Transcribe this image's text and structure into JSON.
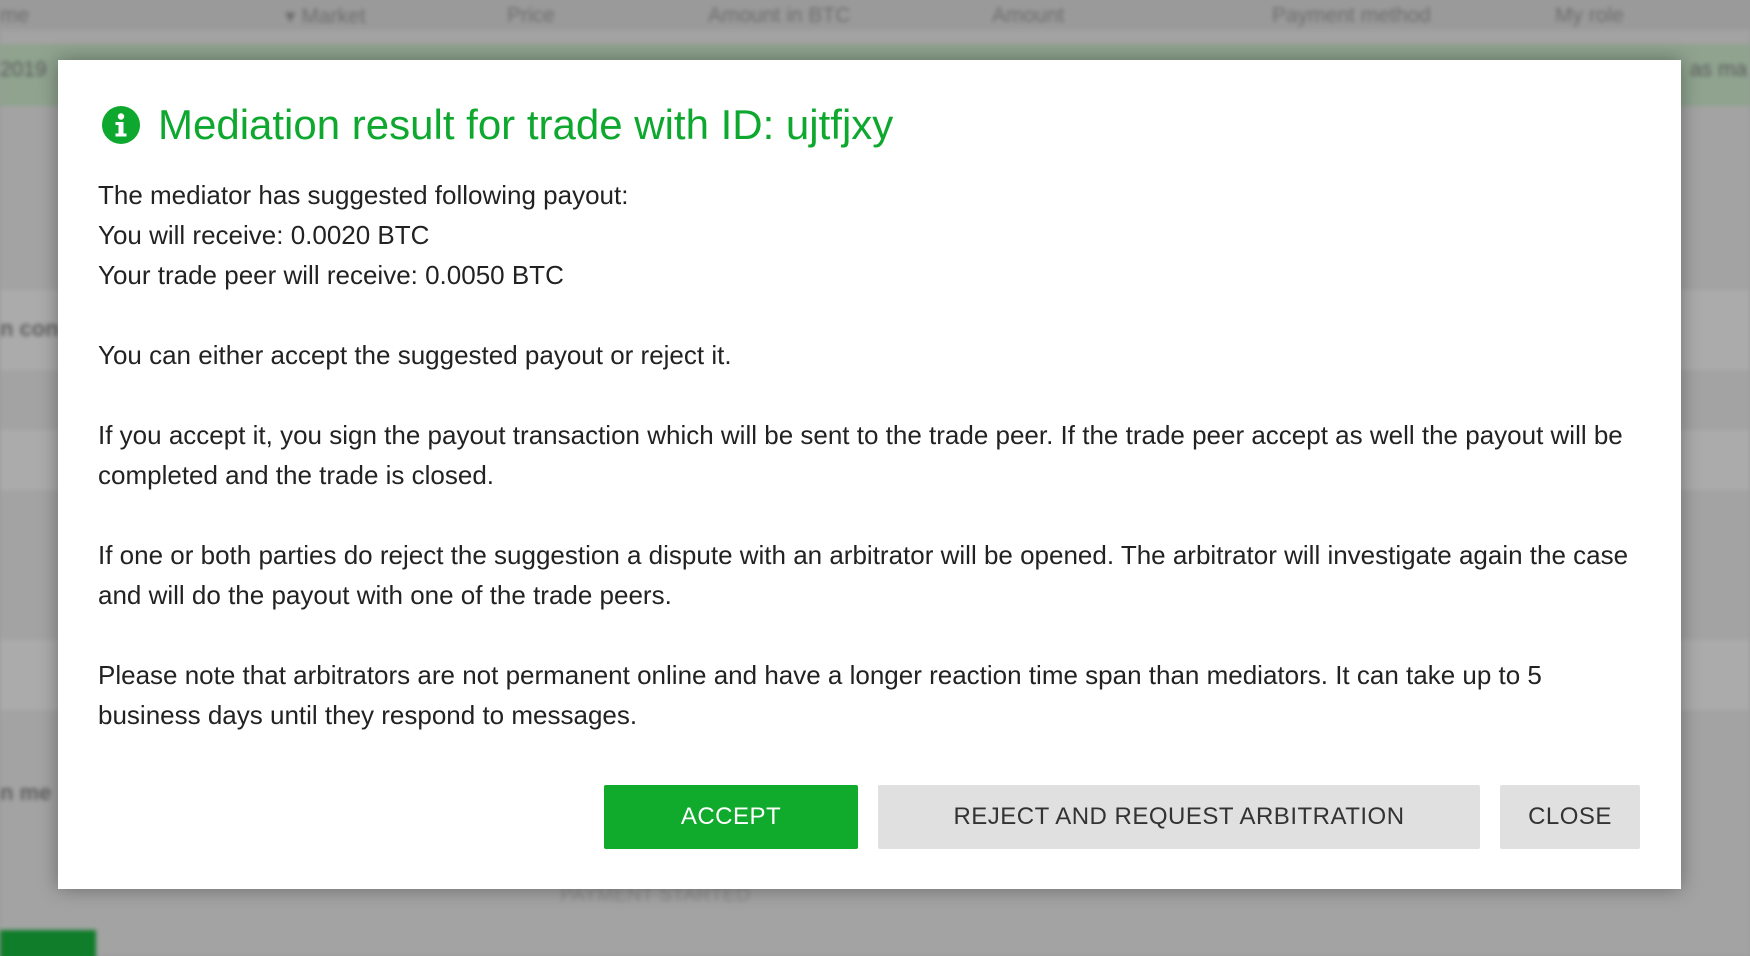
{
  "background": {
    "columns": [
      "me",
      "▾ Market",
      "Price",
      "Amount in BTC",
      "Amount",
      "Payment method",
      "My role"
    ],
    "row_date": "2019",
    "row_tail": "as ma",
    "side_texts": [
      "n con",
      "n me"
    ],
    "status_text": "PAYMENT STARTED"
  },
  "dialog": {
    "icon": "info-icon",
    "title": "Mediation result for trade with ID: ujtfjxy",
    "accent_color": "#0ea82f",
    "lines": {
      "intro": "The mediator has suggested following payout:",
      "you_receive": "You will receive: 0.0020 BTC",
      "peer_receive": "Your trade peer will receive: 0.0050 BTC",
      "choice": "You can either accept the suggested payout or reject it.",
      "accept_info": "If you accept it, you sign the payout transaction which will be sent to the trade peer. If the trade peer accept as well the payout will be completed and the trade is closed.",
      "reject_info": "If one or both parties do reject the suggestion a dispute with an arbitrator will be opened. The arbitrator will investigate again the case and will do the payout with one of the trade peers.",
      "note": "Please note that arbitrators are not permanent online and have a longer reaction time span than mediators. It can take up to 5 business days until they respond to messages."
    },
    "buttons": {
      "accept": "ACCEPT",
      "reject": "REJECT AND REQUEST ARBITRATION",
      "close": "CLOSE"
    }
  }
}
